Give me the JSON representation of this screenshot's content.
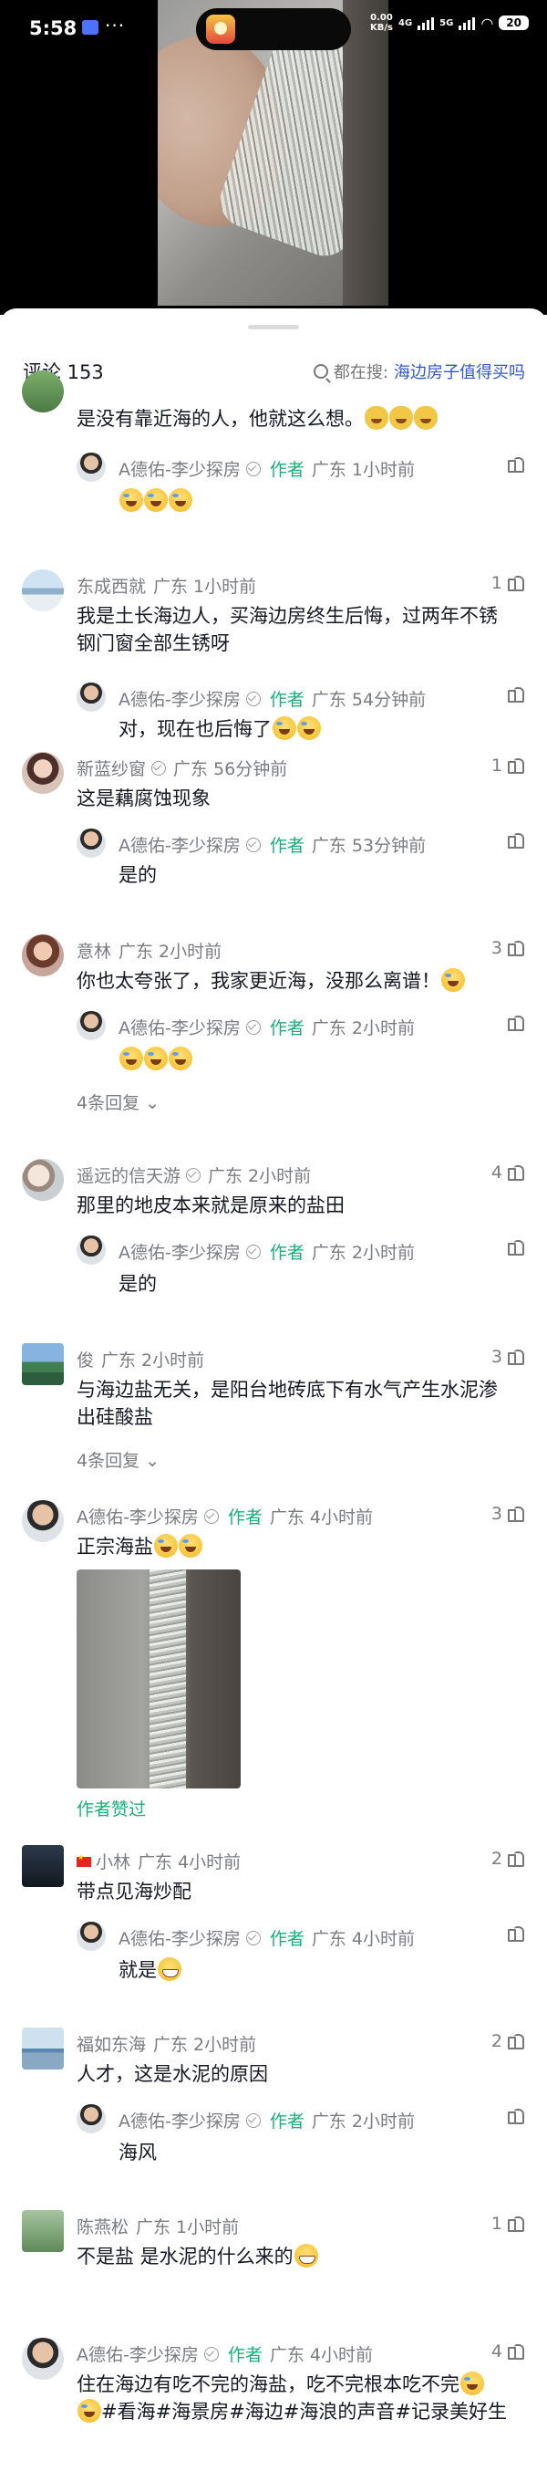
{
  "status_bar": {
    "time": "5:58",
    "more_glyph": "···",
    "net_speed_top": "0.00",
    "net_speed_bottom": "KB/s",
    "network": "4G",
    "network2": "5G",
    "battery": "20"
  },
  "sheet": {
    "comment_count": "评论 153",
    "search_prefix": "都在搜:",
    "search_term": "海边房子值得买吗"
  },
  "author_name": "A德佑-李少探房",
  "author_tag": "作者",
  "c0": {
    "text": "是没有靠近海的人，他就这么想。",
    "reply_meta": "广东  1小时前"
  },
  "c1": {
    "name": "东成西就",
    "meta": "广东  1小时前",
    "likes": "1",
    "text1": "我是土长海边人，买海边房终生后悔，过两年不锈",
    "text2": "钢门窗全部生锈呀",
    "reply_meta": "广东  54分钟前",
    "reply_text": "对，现在也后悔了"
  },
  "c2": {
    "name": "新蓝纱窗",
    "meta": "广东  56分钟前",
    "likes": "1",
    "text": "这是藕腐蚀现象",
    "reply_meta": "广东  53分钟前",
    "reply_text": "是的"
  },
  "c3": {
    "name": "意林",
    "meta": "广东  2小时前",
    "likes": "3",
    "text": "你也太夸张了，我家更近海，没那么离谱！",
    "reply_meta": "广东  2小时前",
    "more": "4条回复"
  },
  "c4": {
    "name": "遥远的信天游",
    "meta": "广东  2小时前",
    "likes": "4",
    "text": "那里的地皮本来就是原来的盐田",
    "reply_meta": "广东  2小时前",
    "reply_text": "是的"
  },
  "c5": {
    "name": "俊",
    "meta": "广东  2小时前",
    "likes": "3",
    "text1": "与海边盐无关，是阳台地砖底下有水气产生水泥渗",
    "text2": "出硅酸盐",
    "more": "4条回复"
  },
  "c6": {
    "meta": "广东  4小时前",
    "likes": "3",
    "text": "正宗海盐",
    "liked_label": "作者赞过"
  },
  "c7": {
    "name": "小林",
    "meta": "广东  4小时前",
    "likes": "2",
    "text": "带点见海炒配",
    "reply_meta": "广东  4小时前",
    "reply_text": "就是"
  },
  "c8": {
    "name": "福如东海",
    "meta": "广东  2小时前",
    "likes": "2",
    "text": "人才，这是水泥的原因",
    "reply_meta": "广东  2小时前",
    "reply_text": "海风"
  },
  "c9": {
    "name": "陈燕松",
    "meta": "广东  1小时前",
    "likes": "1",
    "text": "不是盐 是水泥的什么来的"
  },
  "c10": {
    "meta": "广东  4小时前",
    "likes": "4",
    "text1": "住在海边有吃不完的海盐，吃不完根本吃不完",
    "text2": "#看海#海景房#海边#海浪的声音#记录美好生"
  },
  "icons": {
    "search": "search-icon",
    "like": "thumbs-up-icon",
    "verified": "verified-check-icon",
    "expand": "chevron-down-icon"
  }
}
